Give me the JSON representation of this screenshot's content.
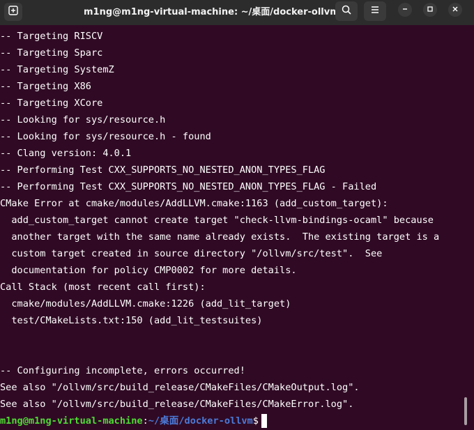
{
  "window": {
    "title": "m1ng@m1ng-virtual-machine: ~/桌面/docker-ollvm"
  },
  "icons": {
    "new_tab": "new-tab-icon",
    "search": "search-icon",
    "menu": "hamburger-menu-icon",
    "minimize": "minimize-icon",
    "maximize": "maximize-icon",
    "close": "close-icon"
  },
  "terminal": {
    "lines": [
      "-- Targeting RISCV",
      "-- Targeting Sparc",
      "-- Targeting SystemZ",
      "-- Targeting X86",
      "-- Targeting XCore",
      "-- Looking for sys/resource.h",
      "-- Looking for sys/resource.h - found",
      "-- Clang version: 4.0.1",
      "-- Performing Test CXX_SUPPORTS_NO_NESTED_ANON_TYPES_FLAG",
      "-- Performing Test CXX_SUPPORTS_NO_NESTED_ANON_TYPES_FLAG - Failed",
      "CMake Error at cmake/modules/AddLLVM.cmake:1163 (add_custom_target):",
      "  add_custom_target cannot create target \"check-llvm-bindings-ocaml\" because",
      "  another target with the same name already exists.  The existing target is a",
      "  custom target created in source directory \"/ollvm/src/test\".  See",
      "  documentation for policy CMP0002 for more details.",
      "Call Stack (most recent call first):",
      "  cmake/modules/AddLLVM.cmake:1226 (add_lit_target)",
      "  test/CMakeLists.txt:150 (add_lit_testsuites)",
      "",
      "",
      "-- Configuring incomplete, errors occurred!",
      "See also \"/ollvm/src/build_release/CMakeFiles/CMakeOutput.log\".",
      "See also \"/ollvm/src/build_release/CMakeFiles/CMakeError.log\"."
    ],
    "prompt": {
      "user": "m1ng@m1ng-virtual-machine",
      "separator": ":",
      "path": "~/桌面/docker-ollvm",
      "sign": "$"
    }
  },
  "colors": {
    "background": "#300a24",
    "titlebar": "#2c2c2c",
    "prompt_user": "#4edc34",
    "prompt_path": "#4b7ad8",
    "text": "#ffffff"
  }
}
